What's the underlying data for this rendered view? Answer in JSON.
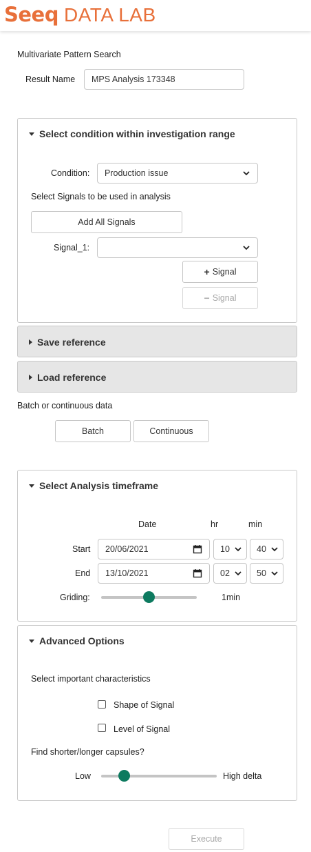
{
  "header": {
    "logo_seeq": "Seeq",
    "logo_datalab": "DATA LAB",
    "brand_color": "#e8703a"
  },
  "form": {
    "title": "Multivariate Pattern Search",
    "result_name_label": "Result Name",
    "result_name_value": "MPS Analysis 173348"
  },
  "condition_panel": {
    "title": "Select condition within investigation range",
    "condition_label": "Condition:",
    "condition_value": "Production issue",
    "signals_instruction": "Select Signals to be used in analysis",
    "add_all_label": "Add All Signals",
    "signal_label": "Signal_1:",
    "signal_value": "",
    "add_signal_label": "Signal",
    "remove_signal_label": "Signal"
  },
  "save_reference": {
    "title": "Save reference"
  },
  "load_reference": {
    "title": "Load reference"
  },
  "data_type": {
    "label": "Batch or continuous data",
    "batch_label": "Batch",
    "continuous_label": "Continuous"
  },
  "timeframe_panel": {
    "title": "Select Analysis timeframe",
    "date_header": "Date",
    "hr_header": "hr",
    "min_header": "min",
    "start_label": "Start",
    "start_date": "20/06/2021",
    "start_hr": "10",
    "start_min": "40",
    "end_label": "End",
    "end_date": "13/10/2021",
    "end_hr": "02",
    "end_min": "50",
    "griding_label": "Griding:",
    "griding_value": "1min",
    "griding_position": 0.5
  },
  "advanced_panel": {
    "title": "Advanced Options",
    "characteristics_label": "Select important characteristics",
    "shape_label": "Shape of Signal",
    "shape_checked": false,
    "level_label": "Level of Signal",
    "level_checked": false,
    "capsules_label": "Find shorter/longer capsules?",
    "low_label": "Low",
    "high_label": "High delta",
    "delta_position": 0.2
  },
  "execute_label": "Execute",
  "accent_color": "#0d7a5f"
}
